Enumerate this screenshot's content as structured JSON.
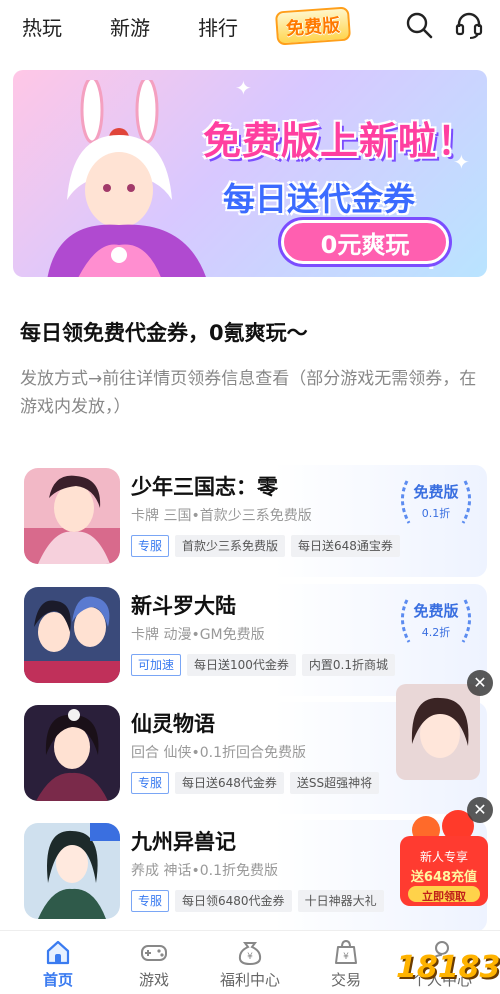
{
  "topnav": {
    "tabs": [
      {
        "label": "热玩"
      },
      {
        "label": "新游"
      },
      {
        "label": "排行"
      },
      {
        "label": "免费版"
      }
    ]
  },
  "banner": {
    "headline": "免费版上新啦！",
    "sub": "每日送代金券",
    "pill": "0元爽玩"
  },
  "promo": {
    "title": "每日领免费代金券，0氪爽玩～",
    "desc": "发放方式→前往详情页领券信息查看（部分游戏无需领券，在游戏内发放，）"
  },
  "games": [
    {
      "name": "少年三国志：零",
      "tags": "卡牌 三国•首款少三系免费版",
      "labels": [
        {
          "text": "专服",
          "style": "blue"
        },
        {
          "text": "首款少三系免费版",
          "style": "gray"
        },
        {
          "text": "每日送648通宝券",
          "style": "gray"
        }
      ],
      "badge": {
        "title": "免费版",
        "rate": "0.1折"
      }
    },
    {
      "name": "新斗罗大陆",
      "tags": "卡牌 动漫•GM免费版",
      "labels": [
        {
          "text": "可加速",
          "style": "blue"
        },
        {
          "text": "每日送100代金券",
          "style": "gray"
        },
        {
          "text": "内置0.1折商城",
          "style": "gray"
        }
      ],
      "badge": {
        "title": "免费版",
        "rate": "4.2折"
      }
    },
    {
      "name": "仙灵物语",
      "tags": "回合 仙侠•0.1折回合免费版",
      "labels": [
        {
          "text": "专服",
          "style": "blue"
        },
        {
          "text": "每日送648代金券",
          "style": "gray"
        },
        {
          "text": "送SS超强神将",
          "style": "gray"
        }
      ],
      "badge": null
    },
    {
      "name": "九州异兽记",
      "tags": "养成 神话•0.1折免费版",
      "labels": [
        {
          "text": "专服",
          "style": "blue"
        },
        {
          "text": "每日领6480代金券",
          "style": "gray"
        },
        {
          "text": "十日神器大礼",
          "style": "gray"
        }
      ],
      "badge": null
    }
  ],
  "floating_ad": {
    "coupon_line1": "新人专享",
    "coupon_line2": "送648充值",
    "coupon_button": "立即领取",
    "close": "✕"
  },
  "bottomnav": {
    "items": [
      {
        "label": "首页",
        "icon": "home-icon",
        "active": true
      },
      {
        "label": "游戏",
        "icon": "gamepad-icon",
        "active": false
      },
      {
        "label": "福利中心",
        "icon": "moneybag-icon",
        "active": false
      },
      {
        "label": "交易",
        "icon": "trade-bag-icon",
        "active": false
      },
      {
        "label": "个人中心",
        "icon": "user-icon",
        "active": false
      }
    ]
  },
  "watermark": "18183",
  "colors": {
    "accent": "#3a7bf0",
    "brand_pink": "#ff3fa0",
    "badge_blue": "#3a6fe0"
  }
}
